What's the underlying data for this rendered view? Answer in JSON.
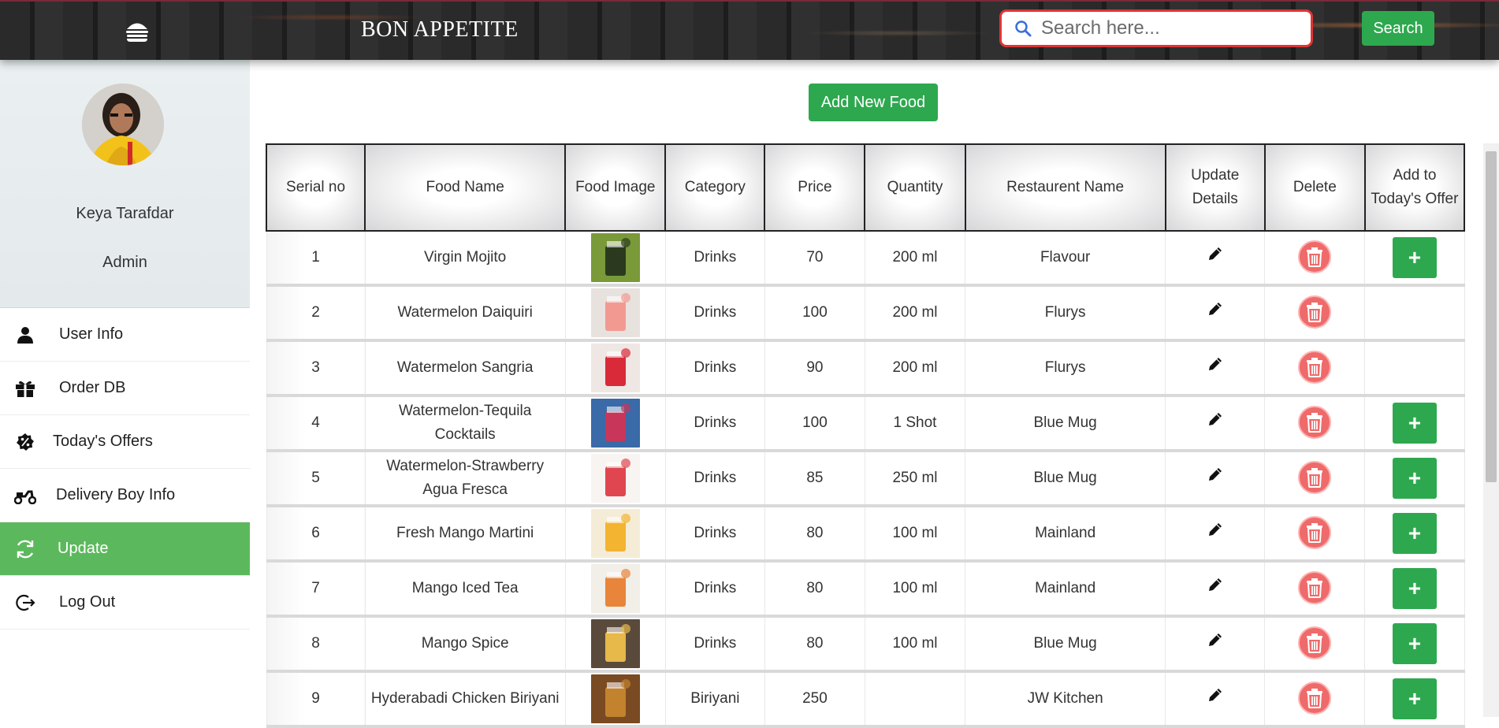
{
  "header": {
    "brand": "BON APPETITE",
    "search_placeholder": "Search here...",
    "search_button": "Search"
  },
  "sidebar": {
    "name": "Keya Tarafdar",
    "role": "Admin",
    "items": [
      {
        "label": "User Info",
        "icon": "user-icon"
      },
      {
        "label": "Order DB",
        "icon": "gift-icon"
      },
      {
        "label": "Today's Offers",
        "icon": "percent-badge-icon"
      },
      {
        "label": "Delivery Boy Info",
        "icon": "scooter-icon"
      },
      {
        "label": "Update",
        "icon": "sync-icon",
        "active": true
      },
      {
        "label": "Log Out",
        "icon": "logout-icon"
      }
    ]
  },
  "main": {
    "add_button": "Add New Food",
    "columns": [
      "Serial no",
      "Food Name",
      "Food Image",
      "Category",
      "Price",
      "Quantity",
      "Restaurent Name",
      "Update Details",
      "Delete",
      "Add to Today's Offer"
    ],
    "rows": [
      {
        "serial": "1",
        "name": "Virgin Mojito",
        "category": "Drinks",
        "price": "70",
        "quantity": "200 ml",
        "restaurant": "Flavour",
        "offer": true,
        "thumb": [
          "#2b3a1e",
          "#7a9a3a"
        ]
      },
      {
        "serial": "2",
        "name": "Watermelon Daiquiri",
        "category": "Drinks",
        "price": "100",
        "quantity": "200 ml",
        "restaurant": "Flurys",
        "offer": false,
        "thumb": [
          "#f29a92",
          "#e8e2de"
        ]
      },
      {
        "serial": "3",
        "name": "Watermelon Sangria",
        "category": "Drinks",
        "price": "90",
        "quantity": "200 ml",
        "restaurant": "Flurys",
        "offer": false,
        "thumb": [
          "#d92a3a",
          "#efe7e4"
        ]
      },
      {
        "serial": "4",
        "name": "Watermelon-Tequila Cocktails",
        "category": "Drinks",
        "price": "100",
        "quantity": "1 Shot",
        "restaurant": "Blue Mug",
        "offer": true,
        "thumb": [
          "#c8375a",
          "#3a6aa8"
        ]
      },
      {
        "serial": "5",
        "name": "Watermelon-Strawberry Agua Fresca",
        "category": "Drinks",
        "price": "85",
        "quantity": "250 ml",
        "restaurant": "Blue Mug",
        "offer": true,
        "thumb": [
          "#e04650",
          "#f7f4f2"
        ]
      },
      {
        "serial": "6",
        "name": "Fresh Mango Martini",
        "category": "Drinks",
        "price": "80",
        "quantity": "100 ml",
        "restaurant": "Mainland",
        "offer": true,
        "thumb": [
          "#f2b431",
          "#f5ecd8"
        ]
      },
      {
        "serial": "7",
        "name": "Mango Iced Tea",
        "category": "Drinks",
        "price": "80",
        "quantity": "100 ml",
        "restaurant": "Mainland",
        "offer": true,
        "thumb": [
          "#e8853a",
          "#f2eee8"
        ]
      },
      {
        "serial": "8",
        "name": "Mango Spice",
        "category": "Drinks",
        "price": "80",
        "quantity": "100 ml",
        "restaurant": "Blue Mug",
        "offer": true,
        "thumb": [
          "#e7b84a",
          "#5a4a3c"
        ]
      },
      {
        "serial": "9",
        "name": "Hyderabadi Chicken Biriyani",
        "category": "Biriyani",
        "price": "250",
        "quantity": "",
        "restaurant": "JW Kitchen",
        "offer": true,
        "thumb": [
          "#c2822e",
          "#7a4a22"
        ]
      }
    ]
  },
  "colors": {
    "accent_green": "#2ea84f",
    "active_nav": "#5cb85c",
    "delete_red": "#ef6a6a",
    "search_border": "#e03434"
  }
}
